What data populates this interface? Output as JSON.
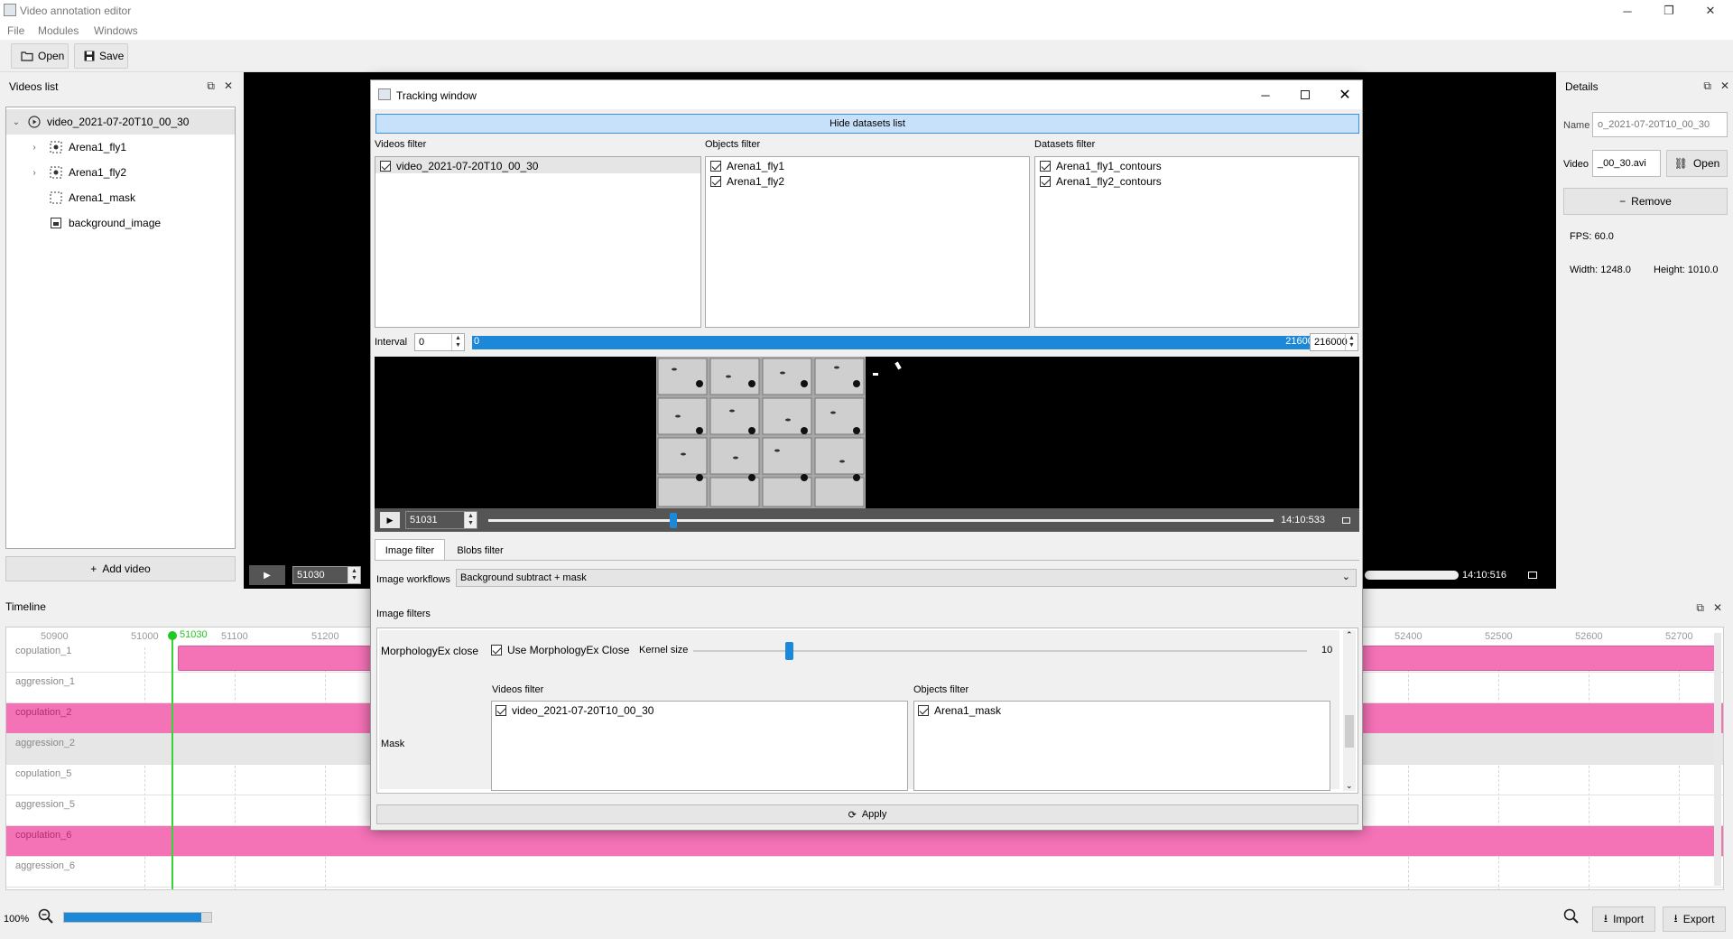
{
  "app": {
    "title": "Video annotation editor"
  },
  "menu": [
    "File",
    "Modules",
    "Windows"
  ],
  "toolbar": {
    "open_label": "Open",
    "save_label": "Save"
  },
  "videos_list": {
    "title": "Videos list",
    "items": [
      {
        "label": "video_2021-07-20T10_00_30",
        "icon": "video-icon"
      },
      {
        "label": "Arena1_fly1",
        "icon": "object-icon"
      },
      {
        "label": "Arena1_fly2",
        "icon": "object-icon"
      },
      {
        "label": "Arena1_mask",
        "icon": "mask-icon"
      },
      {
        "label": "background_image",
        "icon": "image-icon"
      }
    ],
    "add_video_label": "Add video"
  },
  "player_main": {
    "frame_value": "51030",
    "time": "14:10:516"
  },
  "details": {
    "title": "Details",
    "name_label": "Name",
    "name_value": "o_2021-07-20T10_00_30",
    "video_label": "Video",
    "video_value": "_00_30.avi",
    "open_label": "Open",
    "remove_label": "Remove",
    "fps": "FPS: 60.0",
    "width": "Width: 1248.0",
    "height": "Height: 1010.0"
  },
  "timeline": {
    "title": "Timeline",
    "ticks": [
      "50900",
      "51000",
      "51100",
      "51200",
      "52400",
      "52500",
      "52600",
      "52700"
    ],
    "current_frame": "51030",
    "rows": [
      "copulation_1",
      "aggression_1",
      "copulation_2",
      "aggression_2",
      "copulation_5",
      "aggression_5",
      "copulation_6",
      "aggression_6"
    ],
    "row_highlight_color": "#f472b6"
  },
  "bottom": {
    "zoom": "100%",
    "zoom_progress": 0.93,
    "import_label": "Import",
    "export_label": "Export"
  },
  "tracking": {
    "title": "Tracking window",
    "hide_datasets_label": "Hide datasets list",
    "videos_filter_title": "Videos filter",
    "objects_filter_title": "Objects filter",
    "datasets_filter_title": "Datasets filter",
    "videos": [
      "video_2021-07-20T10_00_30"
    ],
    "objects": [
      "Arena1_fly1",
      "Arena1_fly2"
    ],
    "datasets": [
      "Arena1_fly1_contours",
      "Arena1_fly2_contours"
    ],
    "interval_label": "Interval",
    "interval_start": "0",
    "interval_bar_start": "0",
    "interval_bar_end": "216000",
    "interval_end": "216000",
    "frame_value": "51031",
    "time": "14:10:533",
    "seek_progress": 0.236,
    "tabs": [
      "Image filter",
      "Blobs filter"
    ],
    "workflows_label": "Image workflows",
    "workflow_value": "Background subtract + mask",
    "image_filters_label": "Image filters",
    "morph_label": "MorphologyEx close",
    "use_morph_label": "Use MorphologyEx Close",
    "kernel_label": "Kernel size",
    "kernel_value": "10",
    "kernel_fraction": 0.15,
    "mask_label": "Mask",
    "mask_videos_filter": "Videos filter",
    "mask_objects_filter": "Objects filter",
    "mask_video": "video_2021-07-20T10_00_30",
    "mask_object": "Arena1_mask",
    "apply_label": "Apply"
  }
}
